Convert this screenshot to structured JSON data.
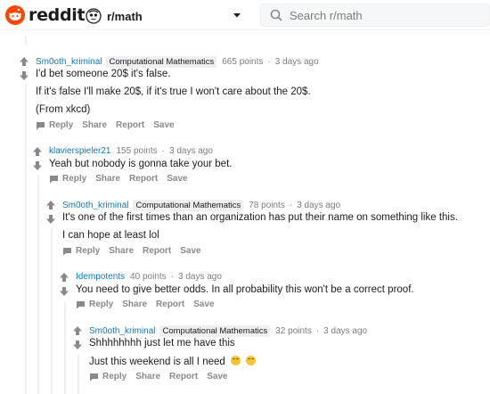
{
  "header": {
    "logo_text": "reddit",
    "community": "r/math",
    "search_placeholder": "Search r/math"
  },
  "comments": [
    {
      "author": "Sm0oth_kriminal",
      "flair": "Computational Mathematics",
      "points": "665 points",
      "time": "3 days ago",
      "lines": [
        "I'd bet someone 20$ it's false.",
        "If it's false I'll make 20$, if it's true I won't care about the 20$.",
        "(From xkcd)"
      ],
      "actions": [
        "Reply",
        "Share",
        "Report",
        "Save"
      ]
    },
    {
      "author": "klavierspieler21",
      "flair": "",
      "points": "155 points",
      "time": "3 days ago",
      "lines": [
        "Yeah but nobody is gonna take your bet."
      ],
      "actions": [
        "Reply",
        "Share",
        "Report",
        "Save"
      ]
    },
    {
      "author": "Sm0oth_kriminal",
      "flair": "Computational Mathematics",
      "points": "78 points",
      "time": "3 days ago",
      "lines": [
        "It's one of the first times than an organization has put their name on something like this.",
        "I can hope at least lol"
      ],
      "actions": [
        "Reply",
        "Share",
        "Report",
        "Save"
      ]
    },
    {
      "author": "Idempotents",
      "flair": "",
      "points": "40 points",
      "time": "3 days ago",
      "lines": [
        "You need to give better odds. In all probability this won't be a correct proof."
      ],
      "actions": [
        "Reply",
        "Share",
        "Report",
        "Save"
      ]
    },
    {
      "author": "Sm0oth_kriminal",
      "flair": "Computational Mathematics",
      "points": "32 points",
      "time": "3 days ago",
      "lines": [
        "Shhhhhhhh just let me have this",
        "Just this weekend is all I need"
      ],
      "actions": [
        "Reply",
        "Share",
        "Report",
        "Save"
      ]
    }
  ],
  "colors": {
    "brand": "#ff4500",
    "link": "#0079d3",
    "meta": "#7c7c7c",
    "action": "#878a8c",
    "thread_line": "#edeff1"
  }
}
